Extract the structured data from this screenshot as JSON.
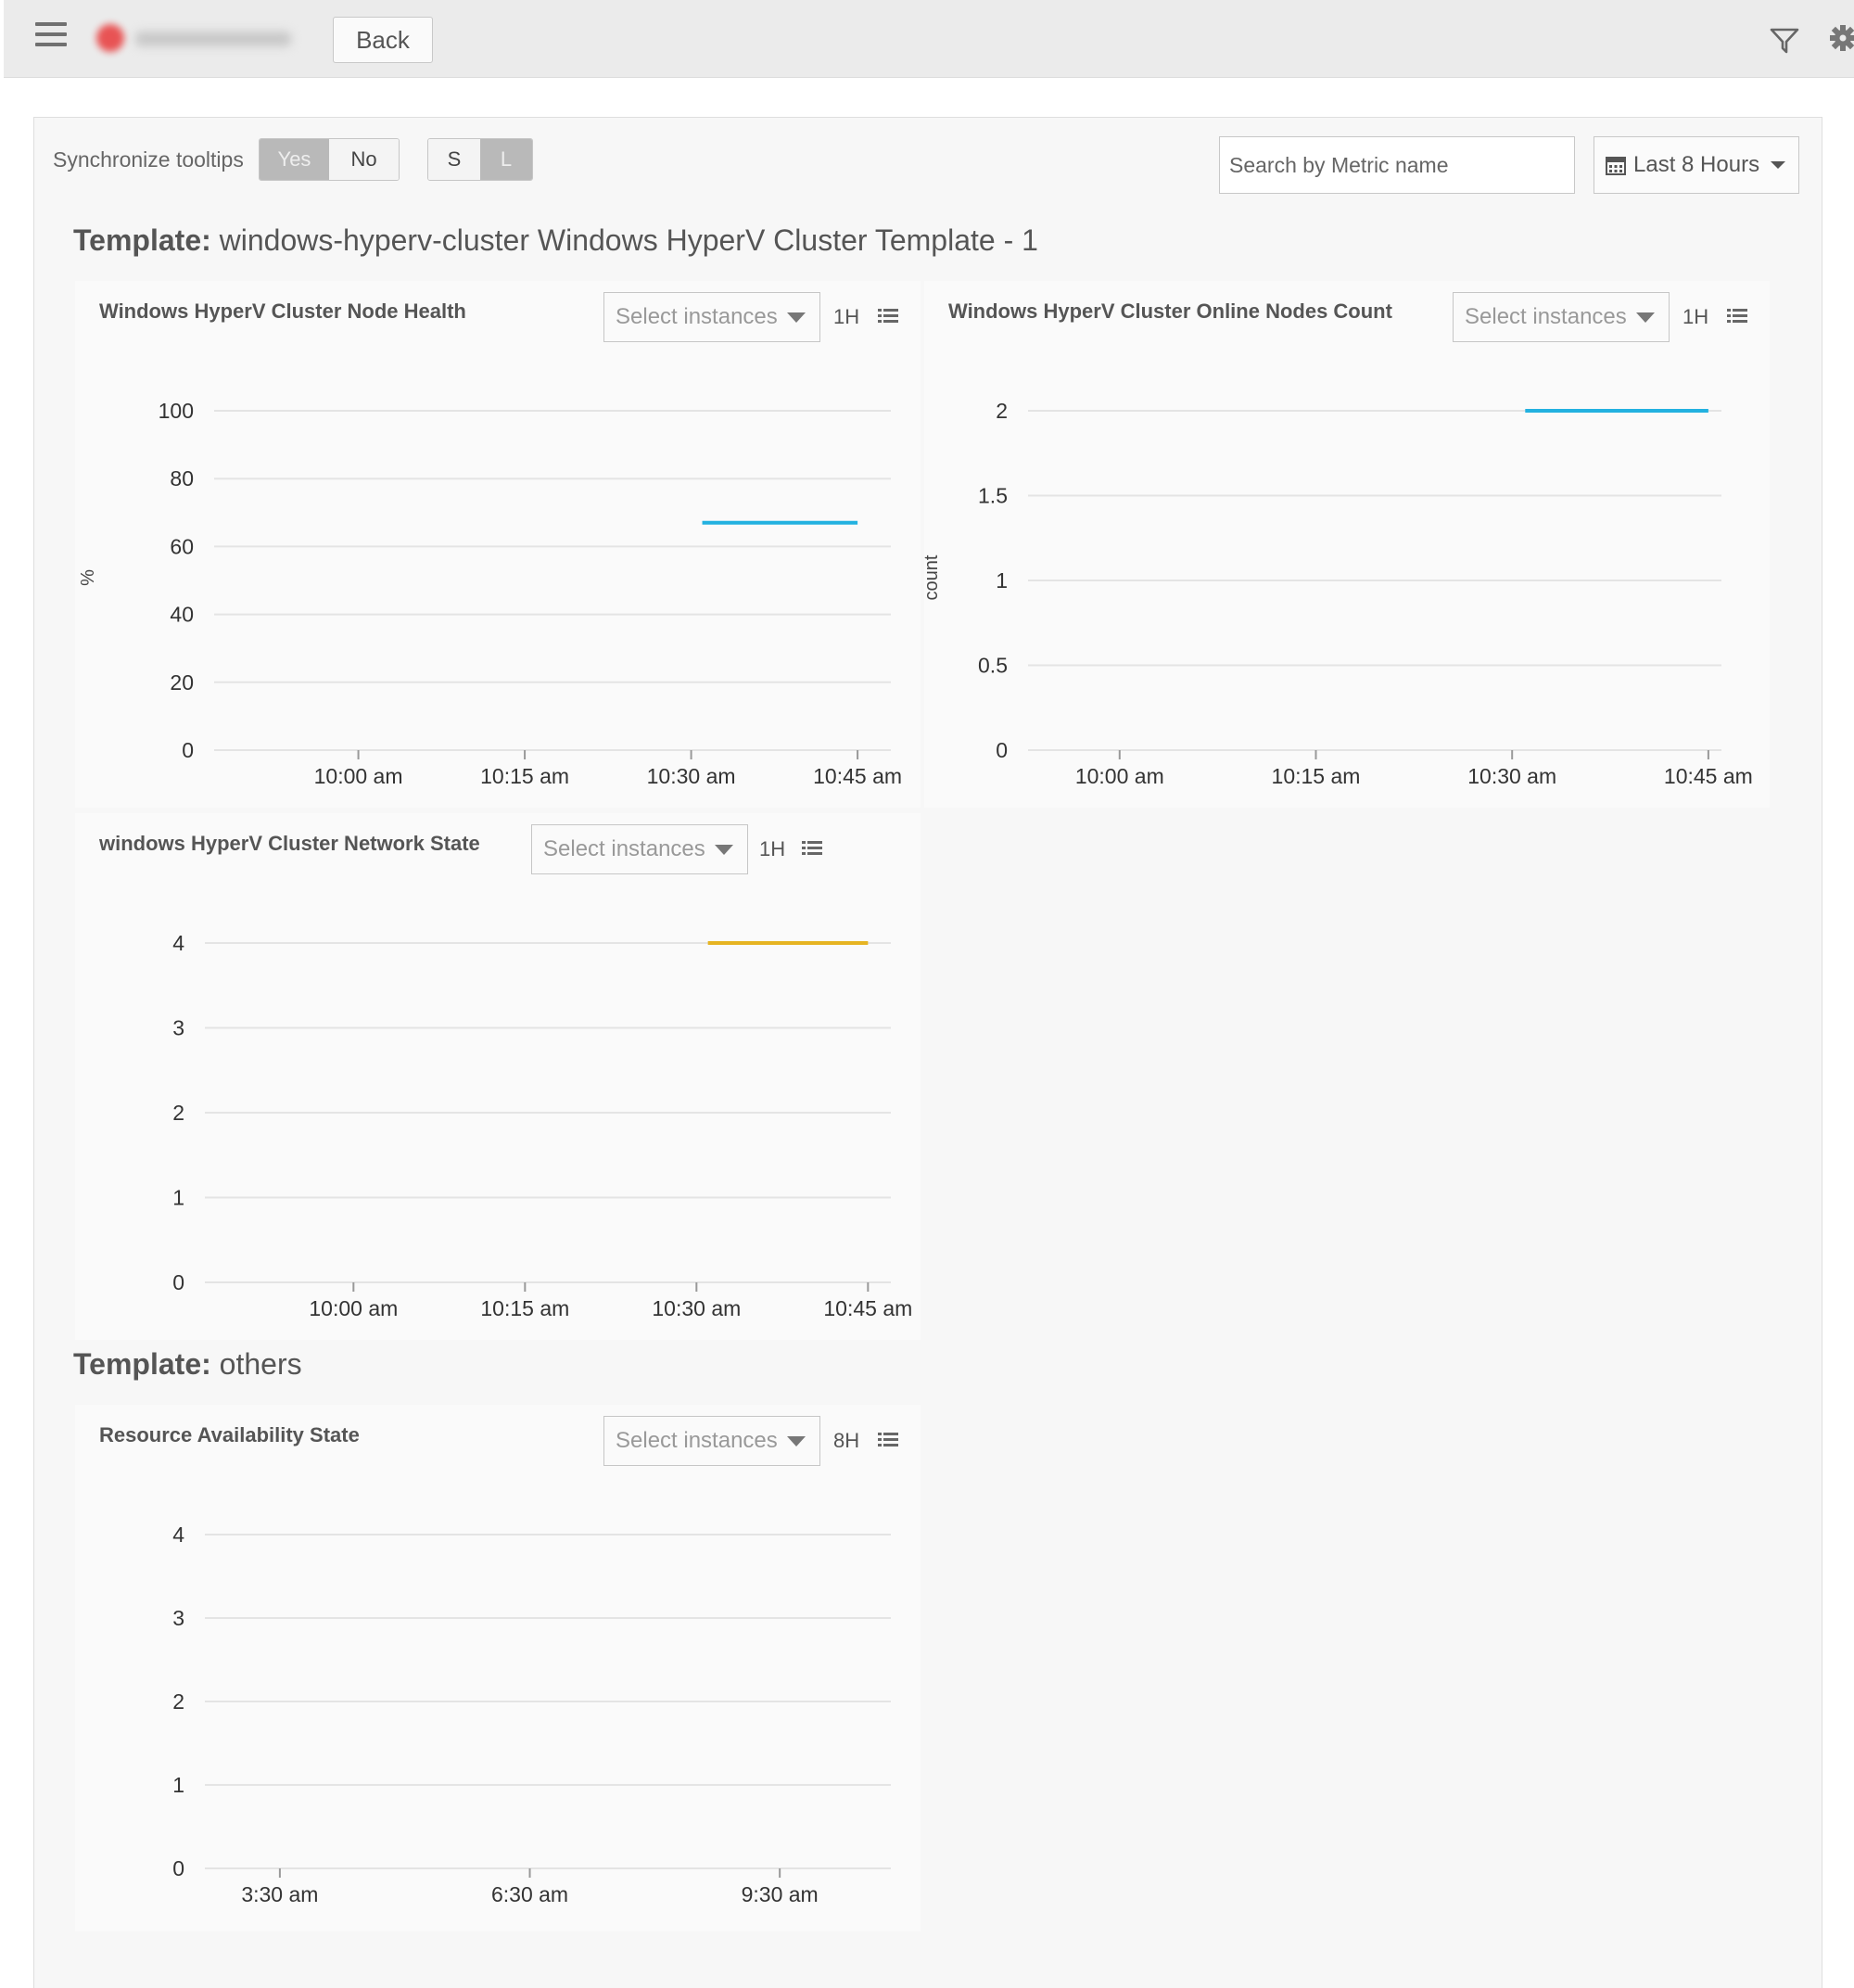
{
  "header": {
    "back_label": "Back"
  },
  "toolbar": {
    "sync_label": "Synchronize tooltips",
    "sync_options": [
      "Yes",
      "No"
    ],
    "sync_selected": "Yes",
    "size_options": [
      "S",
      "L"
    ],
    "size_selected": "L",
    "search_placeholder": "Search by Metric name",
    "time_range": "Last 8 Hours"
  },
  "templates": [
    {
      "prefix": "Template:",
      "name": "windows-hyperv-cluster Windows HyperV Cluster Template - 1"
    },
    {
      "prefix": "Template:",
      "name": "others"
    }
  ],
  "colors": {
    "series_blue": "#22b1e0",
    "series_yellow": "#e6b422",
    "grid": "#e4e4e4",
    "axis_text": "#333333"
  },
  "charts": [
    {
      "title": "Windows HyperV Cluster Node Health",
      "select_placeholder": "Select instances",
      "period": "1H",
      "chart_data": {
        "type": "line",
        "ylabel": "%",
        "ylim": [
          0,
          100
        ],
        "yticks": [
          "0",
          "20",
          "40",
          "60",
          "80",
          "100"
        ],
        "ytick_values": [
          0,
          20,
          40,
          60,
          80,
          100
        ],
        "xlim": [
          "09:47",
          "10:48"
        ],
        "xticks": [
          "10:00 am",
          "10:15 am",
          "10:30 am",
          "10:45 am"
        ],
        "xtick_values": [
          "10:00",
          "10:15",
          "10:30",
          "10:45"
        ],
        "series": [
          {
            "color": "#22b1e0",
            "x": [
              "10:31",
              "10:45"
            ],
            "y": [
              67,
              67
            ]
          }
        ]
      }
    },
    {
      "title": "Windows HyperV Cluster Online Nodes Count",
      "select_placeholder": "Select instances",
      "period": "1H",
      "chart_data": {
        "type": "line",
        "ylabel": "count",
        "ylim": [
          0,
          2
        ],
        "yticks": [
          "0",
          "0.5",
          "1",
          "1.5",
          "2"
        ],
        "ytick_values": [
          0,
          0.5,
          1,
          1.5,
          2
        ],
        "xlim": [
          "09:53",
          "10:46"
        ],
        "xticks": [
          "10:00 am",
          "10:15 am",
          "10:30 am",
          "10:45 am"
        ],
        "xtick_values": [
          "10:00",
          "10:15",
          "10:30",
          "10:45"
        ],
        "series": [
          {
            "color": "#22b1e0",
            "x": [
              "10:31",
              "10:45"
            ],
            "y": [
              2,
              2
            ]
          }
        ]
      }
    },
    {
      "title": "windows HyperV Cluster Network State",
      "select_placeholder": "Select instances",
      "period": "1H",
      "chart_data": {
        "type": "line",
        "ylabel": "",
        "ylim": [
          0,
          4
        ],
        "yticks": [
          "0",
          "1",
          "2",
          "3",
          "4"
        ],
        "ytick_values": [
          0,
          1,
          2,
          3,
          4
        ],
        "xlim": [
          "09:47",
          "10:47"
        ],
        "xticks": [
          "10:00 am",
          "10:15 am",
          "10:30 am",
          "10:45 am"
        ],
        "xtick_values": [
          "10:00",
          "10:15",
          "10:30",
          "10:45"
        ],
        "series": [
          {
            "color": "#e6b422",
            "x": [
              "10:31",
              "10:45"
            ],
            "y": [
              4,
              4
            ]
          }
        ]
      }
    },
    {
      "title": "Resource Availability State",
      "select_placeholder": "Select instances",
      "period": "8H",
      "chart_data": {
        "type": "line",
        "ylabel": "",
        "ylim": [
          0,
          4
        ],
        "yticks": [
          "0",
          "1",
          "2",
          "3",
          "4"
        ],
        "ytick_values": [
          0,
          1,
          2,
          3,
          4
        ],
        "xlim": [
          "02:36",
          "10:50"
        ],
        "xticks": [
          "3:30 am",
          "6:30 am",
          "9:30 am"
        ],
        "xtick_values": [
          "03:30",
          "06:30",
          "09:30"
        ],
        "series": []
      }
    }
  ]
}
